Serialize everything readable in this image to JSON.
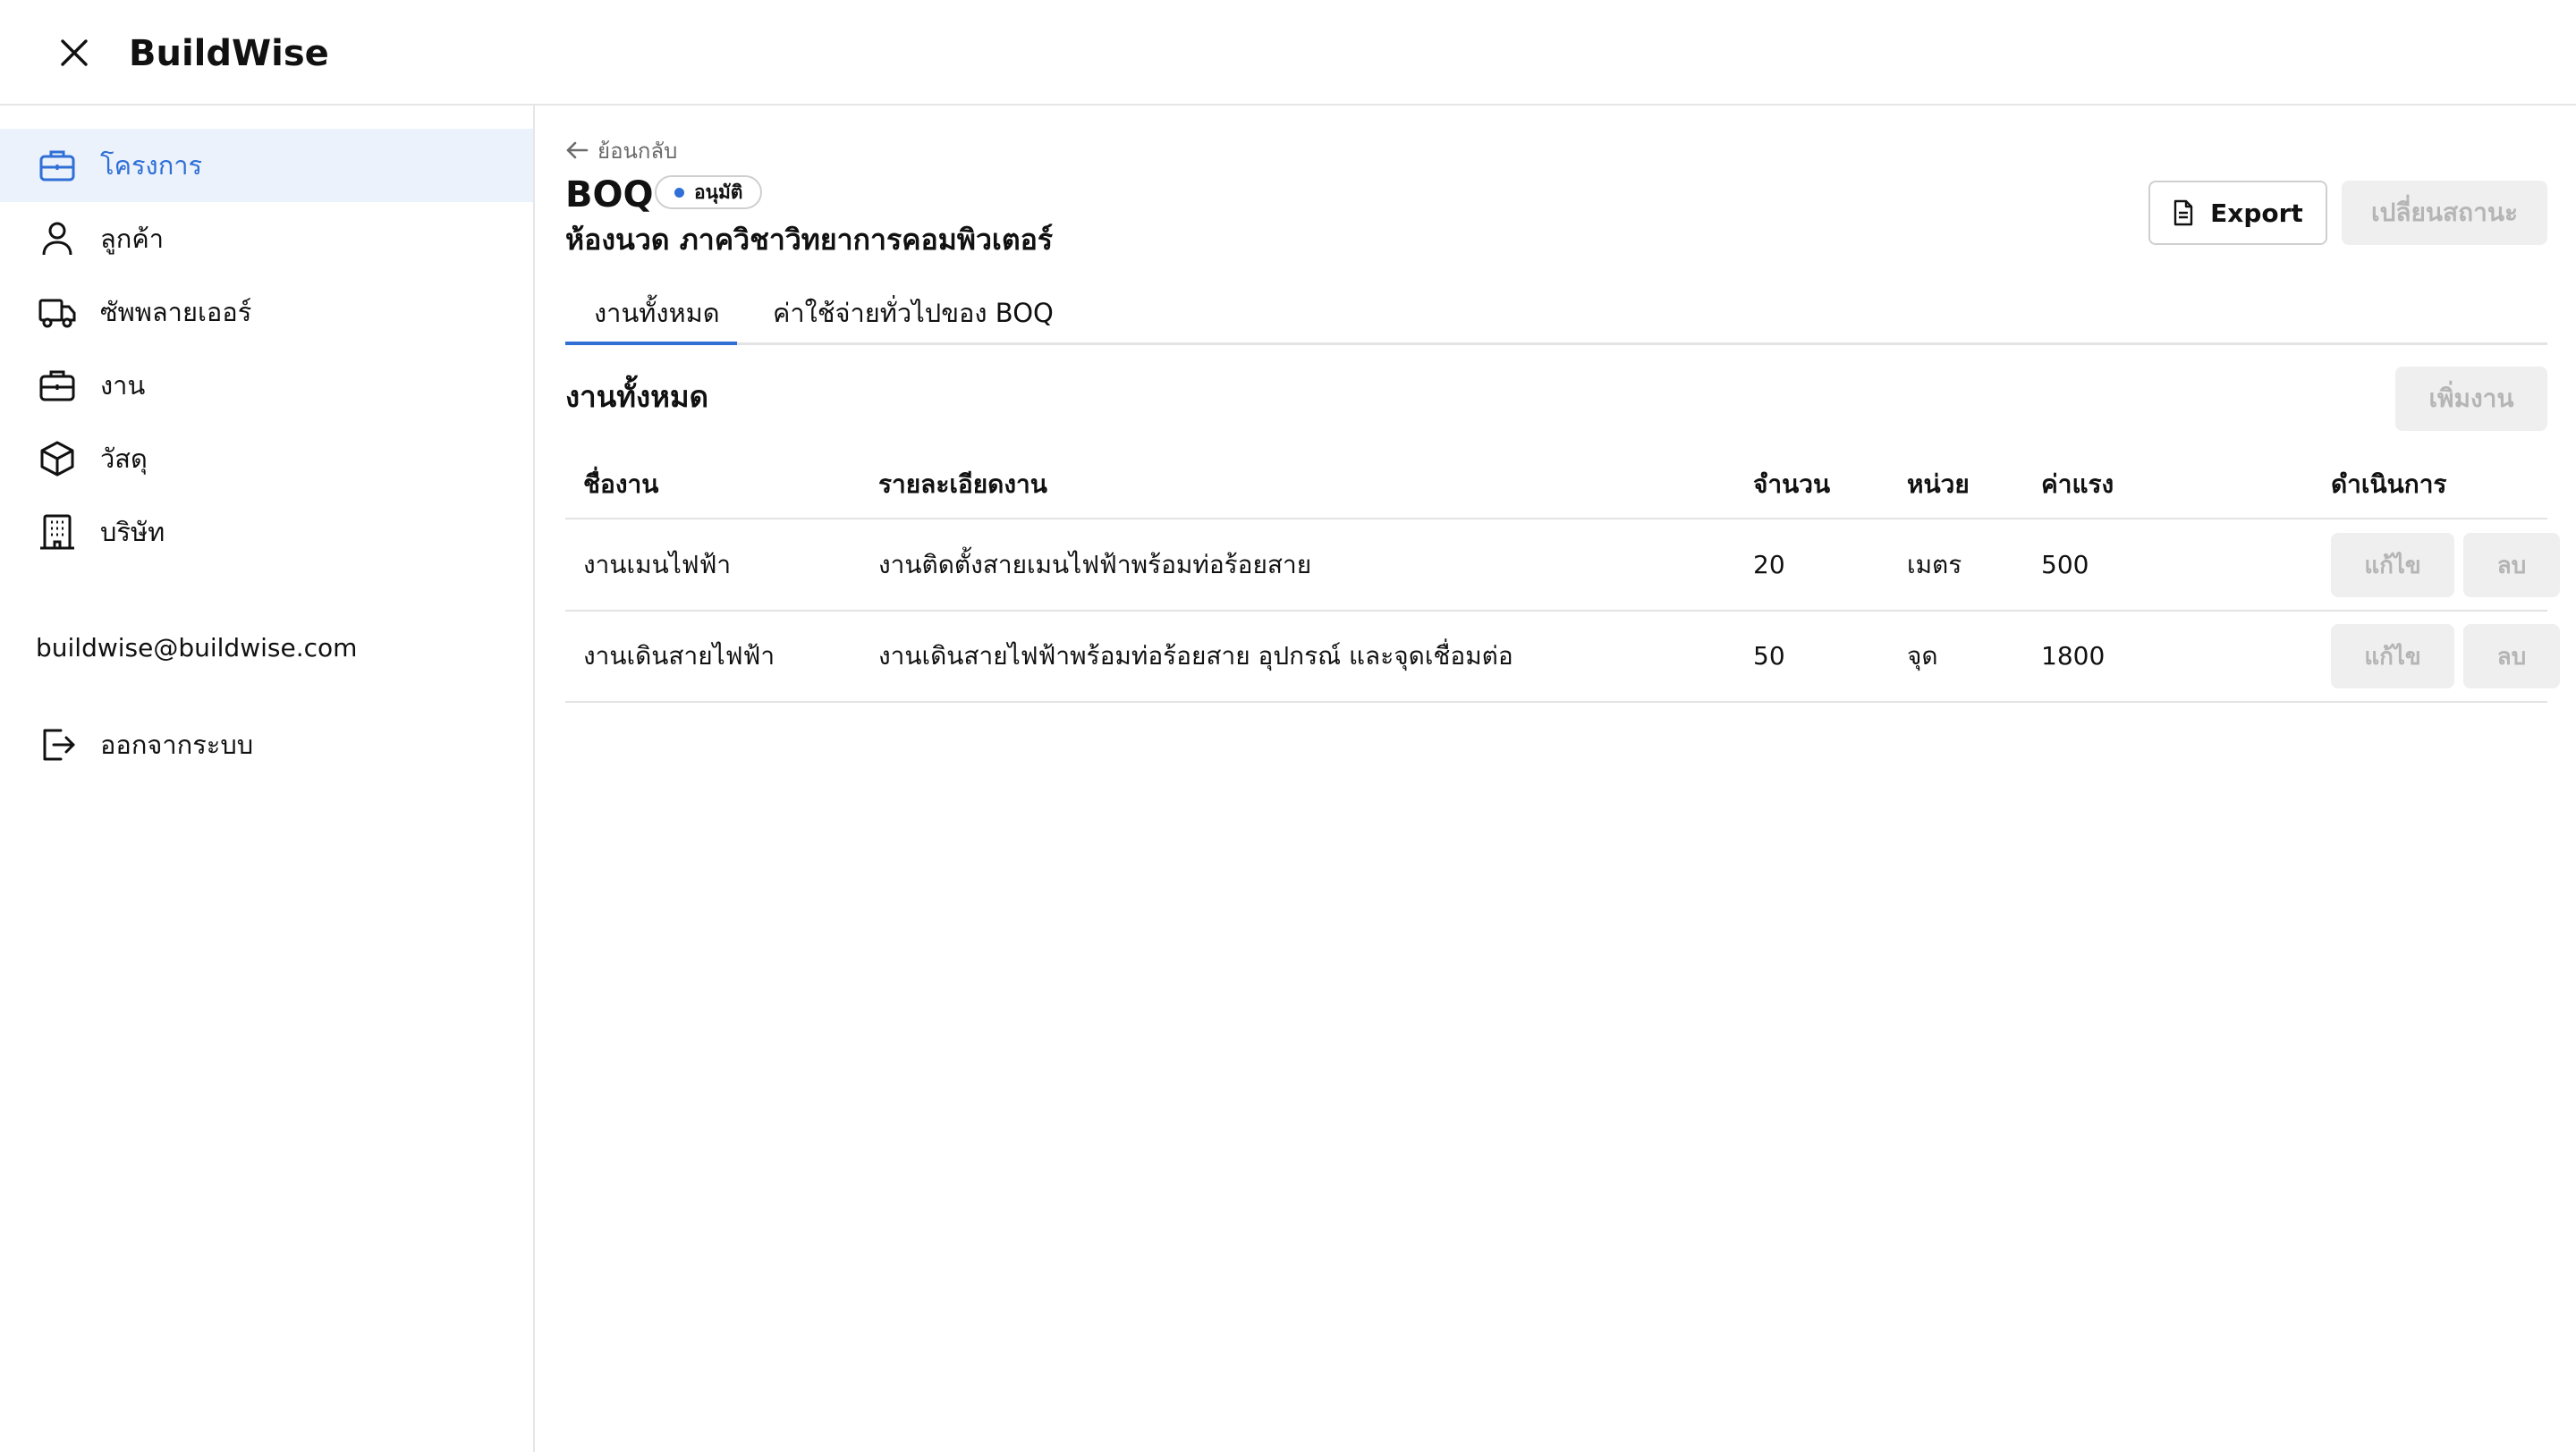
{
  "app": {
    "title": "BuildWise"
  },
  "sidebar": {
    "items": [
      {
        "label": "โครงการ",
        "icon": "briefcase-icon",
        "active": true
      },
      {
        "label": "ลูกค้า",
        "icon": "user-icon"
      },
      {
        "label": "ซัพพลายเออร์",
        "icon": "truck-icon"
      },
      {
        "label": "งาน",
        "icon": "briefcase-icon"
      },
      {
        "label": "วัสดุ",
        "icon": "box-icon"
      },
      {
        "label": "บริษัท",
        "icon": "building-icon"
      }
    ],
    "email": "buildwise@buildwise.com",
    "logout_label": "ออกจากระบบ"
  },
  "main": {
    "back_label": "ย้อนกลับ",
    "title": "BOQ",
    "status_badge": "อนุมัติ",
    "subtitle": "ห้องนวด ภาควิชาวิทยาการคอมพิวเตอร์",
    "export_label": "Export",
    "change_status_label": "เปลี่ยนสถานะ",
    "tabs": [
      {
        "label": "งานทั้งหมด",
        "active": true
      },
      {
        "label": "ค่าใช้จ่ายทั่วไปของ BOQ"
      }
    ],
    "section_title": "งานทั้งหมด",
    "add_task_label": "เพิ่มงาน"
  },
  "table": {
    "headers": [
      "ชื่องาน",
      "รายละเอียดงาน",
      "จำนวน",
      "หน่วย",
      "ค่าแรง",
      "ดำเนินการ"
    ],
    "rows": [
      {
        "name": "งานเมนไฟฟ้า",
        "detail": "งานติดตั้งสายเมนไฟฟ้าพร้อมท่อร้อยสาย",
        "qty": "20",
        "unit": "เมตร",
        "labor": "500",
        "edit": "แก้ไข",
        "delete": "ลบ"
      },
      {
        "name": "งานเดินสายไฟฟ้า",
        "detail": "งานเดินสายไฟฟ้าพร้อมท่อร้อยสาย อุปกรณ์ และจุดเชื่อมต่อ",
        "qty": "50",
        "unit": "จุด",
        "labor": "1800",
        "edit": "แก้ไข",
        "delete": "ลบ"
      }
    ]
  },
  "colors": {
    "accent": "#2f6fd6",
    "active_bg": "#ebf2fc",
    "disabled_bg": "#efefef",
    "disabled_text": "#b5b5b5"
  }
}
